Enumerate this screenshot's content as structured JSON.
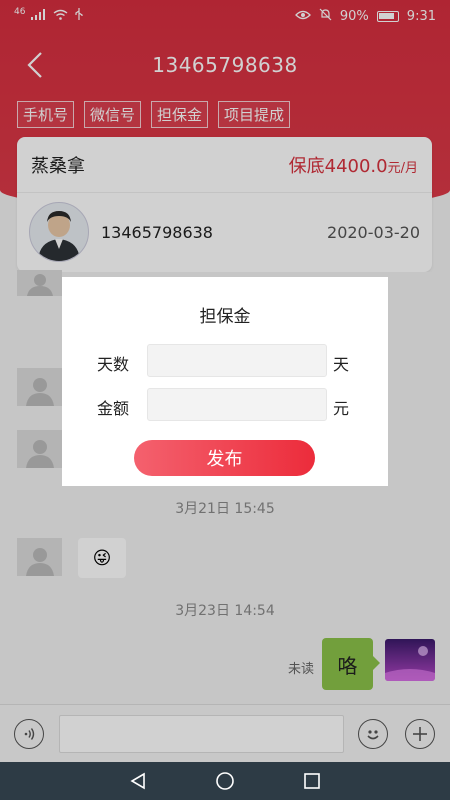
{
  "status_bar": {
    "signal": "46",
    "battery": "90%",
    "time": "9:31"
  },
  "header": {
    "title": "13465798638"
  },
  "tags": [
    "手机号",
    "微信号",
    "担保金",
    "项目提成"
  ],
  "card": {
    "name": "蒸桑拿",
    "salary": "保底4400.0",
    "salary_unit": "元/月",
    "phone": "13465798638",
    "date": "2020-03-20"
  },
  "chat": {
    "timestamps": [
      "3月21日 15:45",
      "3月23日 14:54"
    ],
    "emoji": "😜",
    "unread_label": "未读",
    "last_message": "咯"
  },
  "dialog": {
    "title": "担保金",
    "days_label": "天数",
    "days_value": "",
    "days_unit": "天",
    "amount_label": "金额",
    "amount_value": "",
    "amount_unit": "元",
    "publish_label": "发布"
  },
  "input_bar": {
    "placeholder": ""
  },
  "colors": {
    "brand_red": "#d62e3f",
    "button_start": "#f4616e",
    "button_end": "#ec2c3b",
    "bubble_green": "#8bc34a"
  }
}
